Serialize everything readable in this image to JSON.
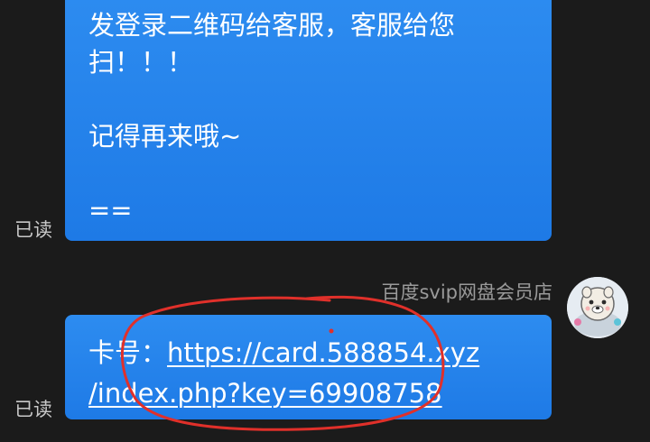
{
  "messages": [
    {
      "lines": [
        "发登录二维码给客服，客服给您",
        "扫！！！",
        "",
        "记得再来哦~",
        "",
        "=="
      ],
      "status": "已读"
    },
    {
      "sender": "百度svip网盘会员店",
      "card_prefix": "卡号：",
      "link_line1": "https://card.588854.xyz",
      "link_line2": "/index.php?key=69908758",
      "status": "已读"
    }
  ],
  "colors": {
    "background": "#1b1b1b",
    "bubble": "#2d8cf0",
    "annotation": "#e0302a"
  },
  "icons": {
    "avatar": "seal-avatar-icon"
  }
}
